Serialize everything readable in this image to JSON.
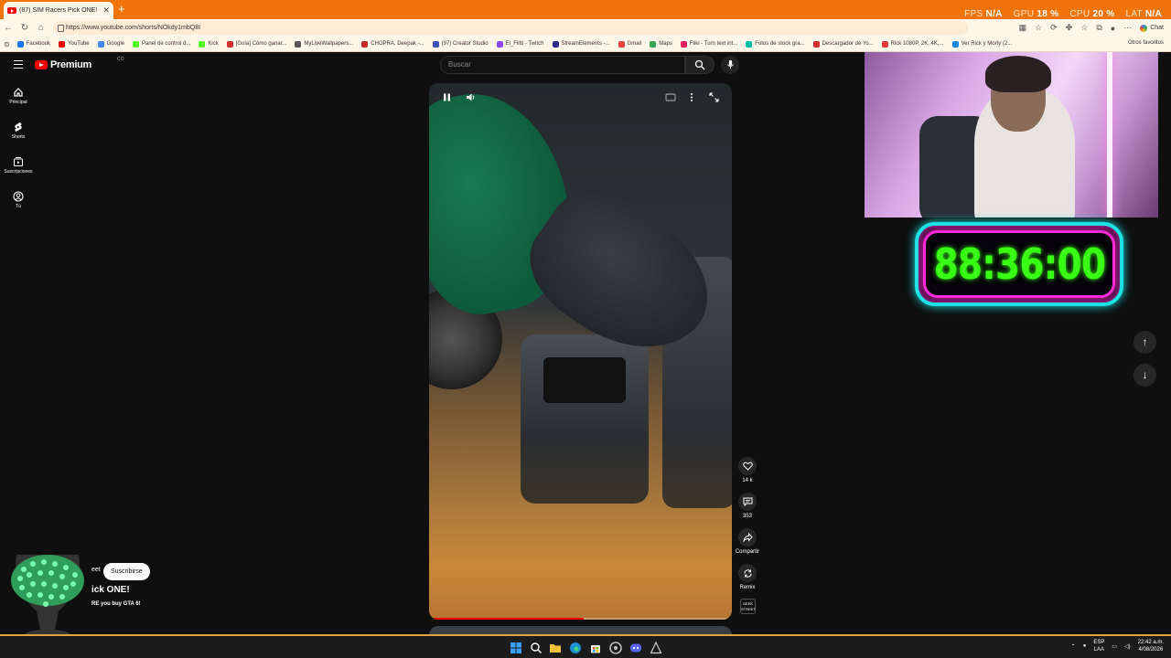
{
  "browser": {
    "tab_title": "(87) SIM Racers Pick ONE! - Y",
    "tab_close": "✕",
    "new_tab": "+",
    "url": "https://www.youtube.com/shorts/NOkdy1mbQ8I",
    "chat_label": "Chat",
    "bookmarks": [
      {
        "label": "Facebook",
        "color": "#1877f2"
      },
      {
        "label": "YouTube",
        "color": "#ff0000"
      },
      {
        "label": "Google",
        "color": "#4285f4"
      },
      {
        "label": "Panel de control d...",
        "color": "#53fc18"
      },
      {
        "label": "Kick",
        "color": "#53fc18"
      },
      {
        "label": "[Guía] Cómo ganar...",
        "color": "#d32f2f"
      },
      {
        "label": "MyLiveWallpapers...",
        "color": "#555555"
      },
      {
        "label": "CHOPRA, Deepak -...",
        "color": "#c62828"
      },
      {
        "label": "(97) Creator Studio",
        "color": "#3f51b5"
      },
      {
        "label": "El_Flitti - Twitch",
        "color": "#9146ff"
      },
      {
        "label": "StreamElements -...",
        "color": "#2e2e8a"
      },
      {
        "label": "Gmail",
        "color": "#ea4335"
      },
      {
        "label": "Maps",
        "color": "#34a853"
      },
      {
        "label": "Fliki - Turn text int...",
        "color": "#e91e63"
      },
      {
        "label": "Fotos de stock gra...",
        "color": "#00bfa5"
      },
      {
        "label": "Descargador de Yo...",
        "color": "#d32f2f"
      },
      {
        "label": "Rick 1080P, 2K, 4K,...",
        "color": "#e53935"
      },
      {
        "label": "Ver Rick y Morty (2...",
        "color": "#1e88e5"
      }
    ],
    "other_bookmarks": "Otros favoritos"
  },
  "overlay_stats": {
    "fps_label": "FPS",
    "fps_value": "N/A",
    "gpu_label": "GPU",
    "gpu_value": "18 %",
    "cpu_label": "CPU",
    "cpu_value": "20 %",
    "lat_label": "LAT",
    "lat_value": "N/A"
  },
  "youtube": {
    "brand": "Premium",
    "region": "CO",
    "search_placeholder": "Buscar",
    "sidebar": [
      {
        "label": "Principal",
        "icon": "home-icon"
      },
      {
        "label": "Shorts",
        "icon": "shorts-icon"
      },
      {
        "label": "Suscripciones",
        "icon": "subscriptions-icon"
      },
      {
        "label": "Tú",
        "icon": "you-icon"
      }
    ],
    "actions": {
      "likes": "14 k",
      "comments": "353",
      "share": "Compartir",
      "remix": "Remix"
    },
    "sound_thumb": "GEEK STREET",
    "channel": "eet",
    "subscribe": "Suscribirse",
    "video_title": "ick ONE!",
    "video_desc": "RE you buy GTA 6!",
    "progress": 0.51
  },
  "stream_overlay": {
    "timer": "88:36:00"
  },
  "taskbar": {
    "lang_top": "ESP",
    "lang_bottom": "LAA",
    "time": "22:42 a.m.",
    "date": "4/08/2026"
  }
}
